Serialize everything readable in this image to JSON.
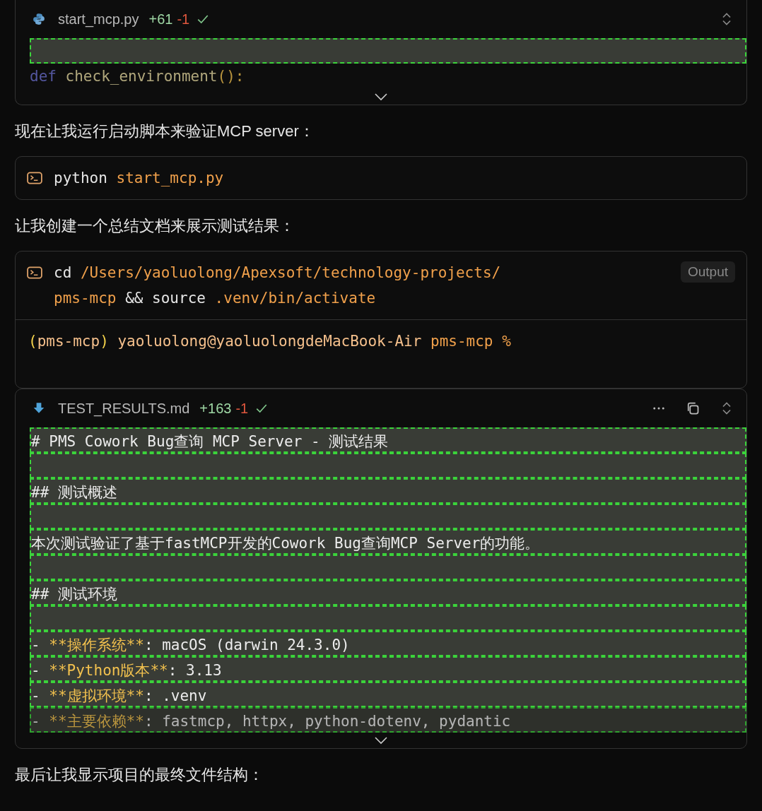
{
  "blocks": [
    {
      "kind": "file",
      "filename": "start_mcp.py",
      "added": "+61",
      "removed": "-1",
      "done": true,
      "actions": false,
      "lines": [
        {
          "added": true,
          "faded": false
        },
        {
          "added": false,
          "faded": true,
          "parts": [
            {
              "text": "def",
              "kind": "keyword"
            },
            {
              "text": " check_environment",
              "kind": "function"
            },
            {
              "text": "():",
              "kind": "punct"
            }
          ]
        }
      ]
    },
    {
      "kind": "prose",
      "text": "现在让我运行启动脚本来验证MCP server："
    },
    {
      "kind": "terminal",
      "command": [
        [
          {
            "text": "python",
            "kind": "plain"
          },
          {
            "text": " start_mcp.py",
            "kind": "arg"
          }
        ]
      ]
    },
    {
      "kind": "prose",
      "text": "让我创建一个总结文档来展示测试结果："
    },
    {
      "kind": "terminal",
      "badge": "Output",
      "command": [
        [
          {
            "text": "cd",
            "kind": "plain"
          },
          {
            "text": " /Users/yaoluolong/Apexsoft/technology-projects/",
            "kind": "arg"
          }
        ],
        [
          {
            "text": "pms-mcp",
            "kind": "arg"
          },
          {
            "text": " && source",
            "kind": "plain"
          },
          {
            "text": " .venv/bin/activate",
            "kind": "arg"
          }
        ]
      ],
      "output": [
        [
          {
            "text": "(",
            "kind": "paren"
          },
          {
            "text": "pms-mcp",
            "kind": "user"
          },
          {
            "text": ")",
            "kind": "paren"
          },
          {
            "text": " yaoluolong@yaoluolongdeMacBook-Air",
            "kind": "user"
          },
          {
            "text": " pms-mcp %",
            "kind": "arg"
          }
        ]
      ]
    },
    {
      "kind": "file",
      "filename": "TEST_RESULTS.md",
      "added": "+163",
      "removed": "-1",
      "done": true,
      "actions": true,
      "lines": [
        {
          "added": true,
          "faded": false,
          "parts": [
            {
              "text": "# PMS Cowork Bug查询 MCP Server - 测试结果",
              "kind": "plain"
            }
          ]
        },
        {
          "added": true,
          "faded": false
        },
        {
          "added": true,
          "faded": false,
          "parts": [
            {
              "text": "## 测试概述",
              "kind": "plain"
            }
          ]
        },
        {
          "added": true,
          "faded": false
        },
        {
          "added": true,
          "faded": false,
          "parts": [
            {
              "text": "本次测试验证了基于fastMCP开发的Cowork Bug查询MCP Server的功能。",
              "kind": "plain"
            }
          ]
        },
        {
          "added": true,
          "faded": false
        },
        {
          "added": true,
          "faded": false,
          "parts": [
            {
              "text": "## 测试环境",
              "kind": "plain"
            }
          ]
        },
        {
          "added": true,
          "faded": false
        },
        {
          "added": true,
          "faded": false,
          "parts": [
            {
              "text": "- ",
              "kind": "plain"
            },
            {
              "text": "**操作系统**",
              "kind": "emphasis"
            },
            {
              "text": ": macOS (darwin 24.3.0)",
              "kind": "plain"
            }
          ]
        },
        {
          "added": true,
          "faded": false,
          "parts": [
            {
              "text": "- ",
              "kind": "plain"
            },
            {
              "text": "**Python版本**",
              "kind": "emphasis"
            },
            {
              "text": ": 3.13",
              "kind": "plain"
            }
          ]
        },
        {
          "added": true,
          "faded": false,
          "parts": [
            {
              "text": "- ",
              "kind": "plain"
            },
            {
              "text": "**虚拟环境**",
              "kind": "emphasis"
            },
            {
              "text": ": .venv",
              "kind": "plain"
            }
          ]
        },
        {
          "added": true,
          "faded": true,
          "parts": [
            {
              "text": "- ",
              "kind": "plain"
            },
            {
              "text": "**主要依赖**",
              "kind": "emphasis"
            },
            {
              "text": ": fastmcp, httpx, python-dotenv, pydantic",
              "kind": "plain"
            }
          ]
        }
      ]
    },
    {
      "kind": "prose",
      "text": "最后让我显示项目的最终文件结构："
    }
  ]
}
